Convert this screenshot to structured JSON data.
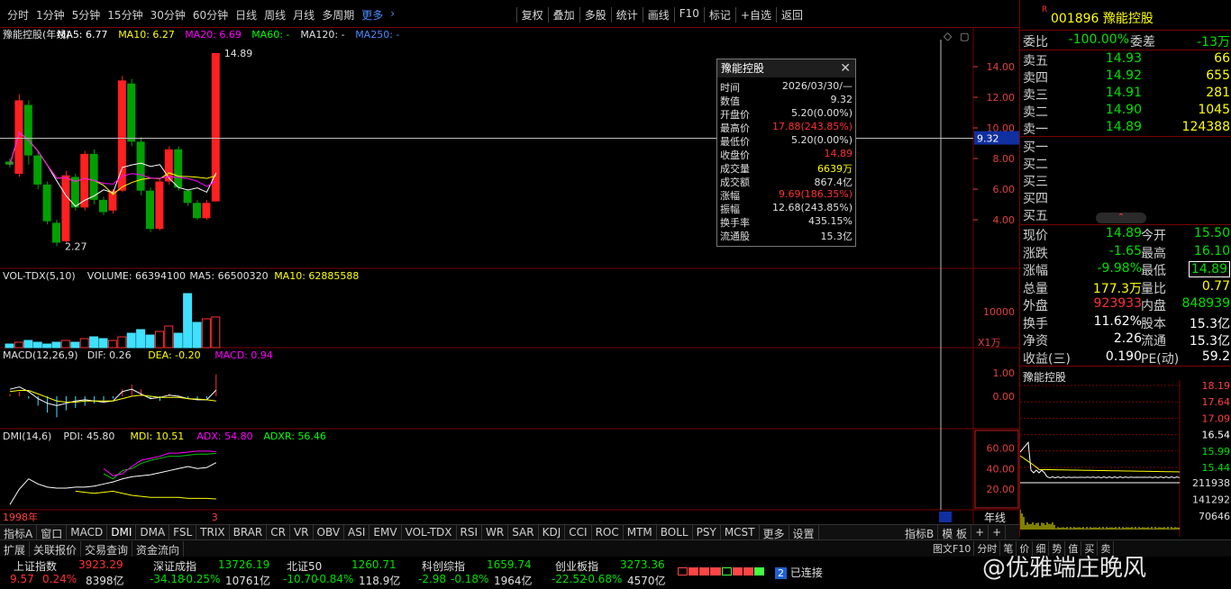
{
  "toolbar": {
    "periods": [
      "分时",
      "1分钟",
      "5分钟",
      "15分钟",
      "30分钟",
      "60分钟",
      "日线",
      "周线",
      "月线",
      "多周期"
    ],
    "selected_period": "年线",
    "more": "更多",
    "tools": [
      "复权",
      "叠加",
      "多股",
      "统计",
      "画线",
      "F10",
      "标记",
      "+自选",
      "返回"
    ]
  },
  "stock": {
    "code": "001896",
    "name": "豫能控股",
    "r_mark": "R"
  },
  "main_panel": {
    "title": "豫能控股(年线)",
    "ma5": "MA5: 6.77",
    "ma10": "MA10: 6.27",
    "ma20": "MA20: 6.69",
    "ma60": "MA60: -",
    "ma120": "MA120: -",
    "ma250": "MA250: -",
    "hi_label": "14.89",
    "lo_label": "2.27",
    "y_ticks": [
      "14.00",
      "12.00",
      "10.00",
      "8.00",
      "6.00",
      "4.00"
    ],
    "cursor_value": "9.32"
  },
  "vol_panel": {
    "title": "VOL-TDX(5,10)",
    "volume": "VOLUME: 66394100",
    "ma5": "MA5: 66500320",
    "ma10": "MA10: 62885588",
    "y_tick": "10000",
    "unit": "X1万"
  },
  "macd_panel": {
    "title": "MACD(12,26,9)",
    "dif": "DIF: 0.26",
    "dea": "DEA: -0.20",
    "macd": "MACD: 0.94",
    "y_ticks": [
      "1.00",
      "0.00"
    ]
  },
  "dmi_panel": {
    "title": "DMI(14,6)",
    "pdi": "PDI: 45.80",
    "mdi": "MDI: 10.51",
    "adx": "ADX: 54.80",
    "adxr": "ADXR: 56.46",
    "y_ticks": [
      "60.00",
      "40.00",
      "20.00"
    ]
  },
  "x_axis": {
    "start": "1998年",
    "end": "3",
    "period": "年线"
  },
  "popup": {
    "title": "豫能控股",
    "rows": [
      {
        "label": "时间",
        "value": "2026/03/30/—",
        "color": "#e0e0e0"
      },
      {
        "label": "数值",
        "value": "9.32",
        "color": "#e0e0e0"
      },
      {
        "label": "开盘价",
        "value": "5.20(0.00%)",
        "color": "#e0e0e0"
      },
      {
        "label": "最高价",
        "value": "17.88(243.85%)",
        "color": "#ff3030"
      },
      {
        "label": "最低价",
        "value": "5.20(0.00%)",
        "color": "#e0e0e0"
      },
      {
        "label": "收盘价",
        "value": "14.89",
        "color": "#ff3030"
      },
      {
        "label": "成交量",
        "value": "6639万",
        "color": "#ffff00"
      },
      {
        "label": "成交额",
        "value": "867.4亿",
        "color": "#e0e0e0"
      },
      {
        "label": "涨幅",
        "value": "9.69(186.35%)",
        "color": "#ff3030"
      },
      {
        "label": "振幅",
        "value": "12.68(243.85%)",
        "color": "#e0e0e0"
      },
      {
        "label": "换手率",
        "value": "435.15%",
        "color": "#e0e0e0"
      },
      {
        "label": "流通股",
        "value": "15.3亿",
        "color": "#e0e0e0"
      }
    ]
  },
  "quote": {
    "weibi_label": "委比",
    "weibi": "-100.00%",
    "weicha_label": "委差",
    "weicha": "-13万",
    "asks": [
      {
        "label": "卖五",
        "price": "14.93",
        "vol": "66"
      },
      {
        "label": "卖四",
        "price": "14.92",
        "vol": "655"
      },
      {
        "label": "卖三",
        "price": "14.91",
        "vol": "281"
      },
      {
        "label": "卖二",
        "price": "14.90",
        "vol": "1045"
      },
      {
        "label": "卖一",
        "price": "14.89",
        "vol": "124388"
      }
    ],
    "bids": [
      "买一",
      "买二",
      "买三",
      "买四",
      "买五"
    ],
    "stats": [
      {
        "l1": "现价",
        "v1": "14.89",
        "c1": "grn",
        "l2": "今开",
        "v2": "15.50",
        "c2": "grn"
      },
      {
        "l1": "涨跌",
        "v1": "-1.65",
        "c1": "grn",
        "l2": "最高",
        "v2": "16.10",
        "c2": "grn"
      },
      {
        "l1": "涨幅",
        "v1": "-9.98%",
        "c1": "grn",
        "l2": "最低",
        "v2": "14.89",
        "c2": "grn"
      },
      {
        "l1": "总量",
        "v1": "177.3万",
        "c1": "ylw",
        "l2": "量比",
        "v2": "0.77",
        "c2": "ylw"
      },
      {
        "l1": "外盘",
        "v1": "923933",
        "c1": "red",
        "l2": "内盘",
        "v2": "848939",
        "c2": "grn"
      },
      {
        "l1": "换手",
        "v1": "11.62%",
        "c1": "wht",
        "l2": "股本",
        "v2": "15.3亿",
        "c2": "wht"
      },
      {
        "l1": "净资",
        "v1": "2.26",
        "c1": "wht",
        "l2": "流通",
        "v2": "15.3亿",
        "c2": "wht"
      },
      {
        "l1": "收益(三)",
        "v1": "0.190",
        "c1": "wht",
        "l2": "PE(动)",
        "v2": "59.2",
        "c2": "wht"
      }
    ]
  },
  "mini_chart": {
    "title": "豫能控股",
    "y_ticks": [
      "18.19",
      "17.64",
      "17.09",
      "16.54",
      "15.99",
      "15.44"
    ],
    "vol_ticks": [
      "211938",
      "141292",
      "70646"
    ]
  },
  "tabs": [
    "指标A",
    "窗口",
    "MACD",
    "DMI",
    "DMA",
    "FSL",
    "TRIX",
    "BRAR",
    "CR",
    "VR",
    "OBV",
    "ASI",
    "EMV",
    "VOL-TDX",
    "RSI",
    "WR",
    "SAR",
    "KDJ",
    "CCI",
    "ROC",
    "MTM",
    "BOLL",
    "PSY",
    "MCST",
    "更多",
    "设置"
  ],
  "tabs_right": [
    "指标B",
    "模 板",
    "+",
    "+"
  ],
  "tabs2": [
    "扩展",
    "关联报价",
    "交易查询",
    "资金流向"
  ],
  "tabs2_right": [
    "图文F10",
    "分时",
    "笔",
    "价",
    "细",
    "势",
    "值",
    "买",
    "卖"
  ],
  "indices": [
    {
      "name": "上证指数",
      "value": "3923.29",
      "chg": "9.57",
      "pct": "0.24%",
      "amt": "8398亿",
      "color": "#ff3030"
    },
    {
      "name": "深证成指",
      "value": "13726.19",
      "chg": "-34.18",
      "pct": "-0.25%",
      "amt": "10761亿",
      "color": "#00e000"
    },
    {
      "name": "北证50",
      "value": "1260.71",
      "chg": "-10.70",
      "pct": "-0.84%",
      "amt": "118.9亿",
      "color": "#00e000"
    },
    {
      "name": "科创综指",
      "value": "1659.74",
      "chg": "-2.98",
      "pct": "-0.18%",
      "amt": "1964亿",
      "color": "#00e000"
    },
    {
      "name": "创业板指",
      "value": "3273.36",
      "chg": "-22.52",
      "pct": "-0.68%",
      "amt": "4570亿",
      "color": "#00e000"
    }
  ],
  "connection": {
    "count": "2",
    "text": "已连接"
  },
  "watermark": "@优雅端庄晚风",
  "colors": {
    "up": "#ff2020",
    "down": "#00a000",
    "ma5": "#ffffff",
    "ma10": "#ffff00",
    "ma20": "#ff00ff",
    "grid": "#7a0000"
  },
  "chart_data": {
    "type": "candlestick",
    "candles": [
      {
        "o": 7.8,
        "c": 7.6,
        "h": 8.0,
        "l": 7.4
      },
      {
        "o": 7.0,
        "c": 11.8,
        "h": 12.2,
        "l": 6.8
      },
      {
        "o": 11.5,
        "c": 8.2,
        "h": 11.8,
        "l": 7.6
      },
      {
        "o": 8.2,
        "c": 6.3,
        "h": 8.5,
        "l": 6.0
      },
      {
        "o": 6.3,
        "c": 3.9,
        "h": 6.5,
        "l": 3.7
      },
      {
        "o": 3.8,
        "c": 2.5,
        "h": 4.0,
        "l": 2.27
      },
      {
        "o": 2.6,
        "c": 6.9,
        "h": 7.2,
        "l": 2.5
      },
      {
        "o": 6.8,
        "c": 4.8,
        "h": 7.0,
        "l": 4.6
      },
      {
        "o": 4.8,
        "c": 8.3,
        "h": 8.5,
        "l": 4.6
      },
      {
        "o": 8.3,
        "c": 5.3,
        "h": 8.6,
        "l": 5.0
      },
      {
        "o": 5.3,
        "c": 4.5,
        "h": 5.5,
        "l": 4.3
      },
      {
        "o": 4.6,
        "c": 5.9,
        "h": 6.0,
        "l": 4.4
      },
      {
        "o": 5.9,
        "c": 13.1,
        "h": 13.4,
        "l": 5.8
      },
      {
        "o": 12.9,
        "c": 9.1,
        "h": 13.2,
        "l": 8.8
      },
      {
        "o": 9.1,
        "c": 5.9,
        "h": 9.4,
        "l": 5.6
      },
      {
        "o": 5.9,
        "c": 3.4,
        "h": 6.1,
        "l": 3.2
      },
      {
        "o": 3.4,
        "c": 6.5,
        "h": 6.7,
        "l": 3.3
      },
      {
        "o": 6.5,
        "c": 8.6,
        "h": 8.8,
        "l": 6.3
      },
      {
        "o": 8.6,
        "c": 6.1,
        "h": 8.8,
        "l": 5.9
      },
      {
        "o": 5.9,
        "c": 5.1,
        "h": 6.0,
        "l": 4.9
      },
      {
        "o": 5.1,
        "c": 4.1,
        "h": 5.3,
        "l": 4.0
      },
      {
        "o": 4.1,
        "c": 5.1,
        "h": 5.3,
        "l": 4.0
      },
      {
        "o": 5.2,
        "c": 14.89,
        "h": 14.89,
        "l": 5.2
      }
    ],
    "ylim": [
      2.0,
      16.0
    ],
    "volume": [
      2,
      3,
      4,
      3,
      2,
      3,
      4,
      3,
      5,
      6,
      5,
      4,
      6,
      8,
      10,
      7,
      9,
      12,
      8,
      30,
      14,
      16,
      17
    ],
    "vol_up": [
      false,
      true,
      false,
      false,
      false,
      false,
      true,
      false,
      true,
      false,
      false,
      true,
      true,
      false,
      false,
      false,
      true,
      true,
      false,
      false,
      false,
      true,
      true
    ]
  }
}
